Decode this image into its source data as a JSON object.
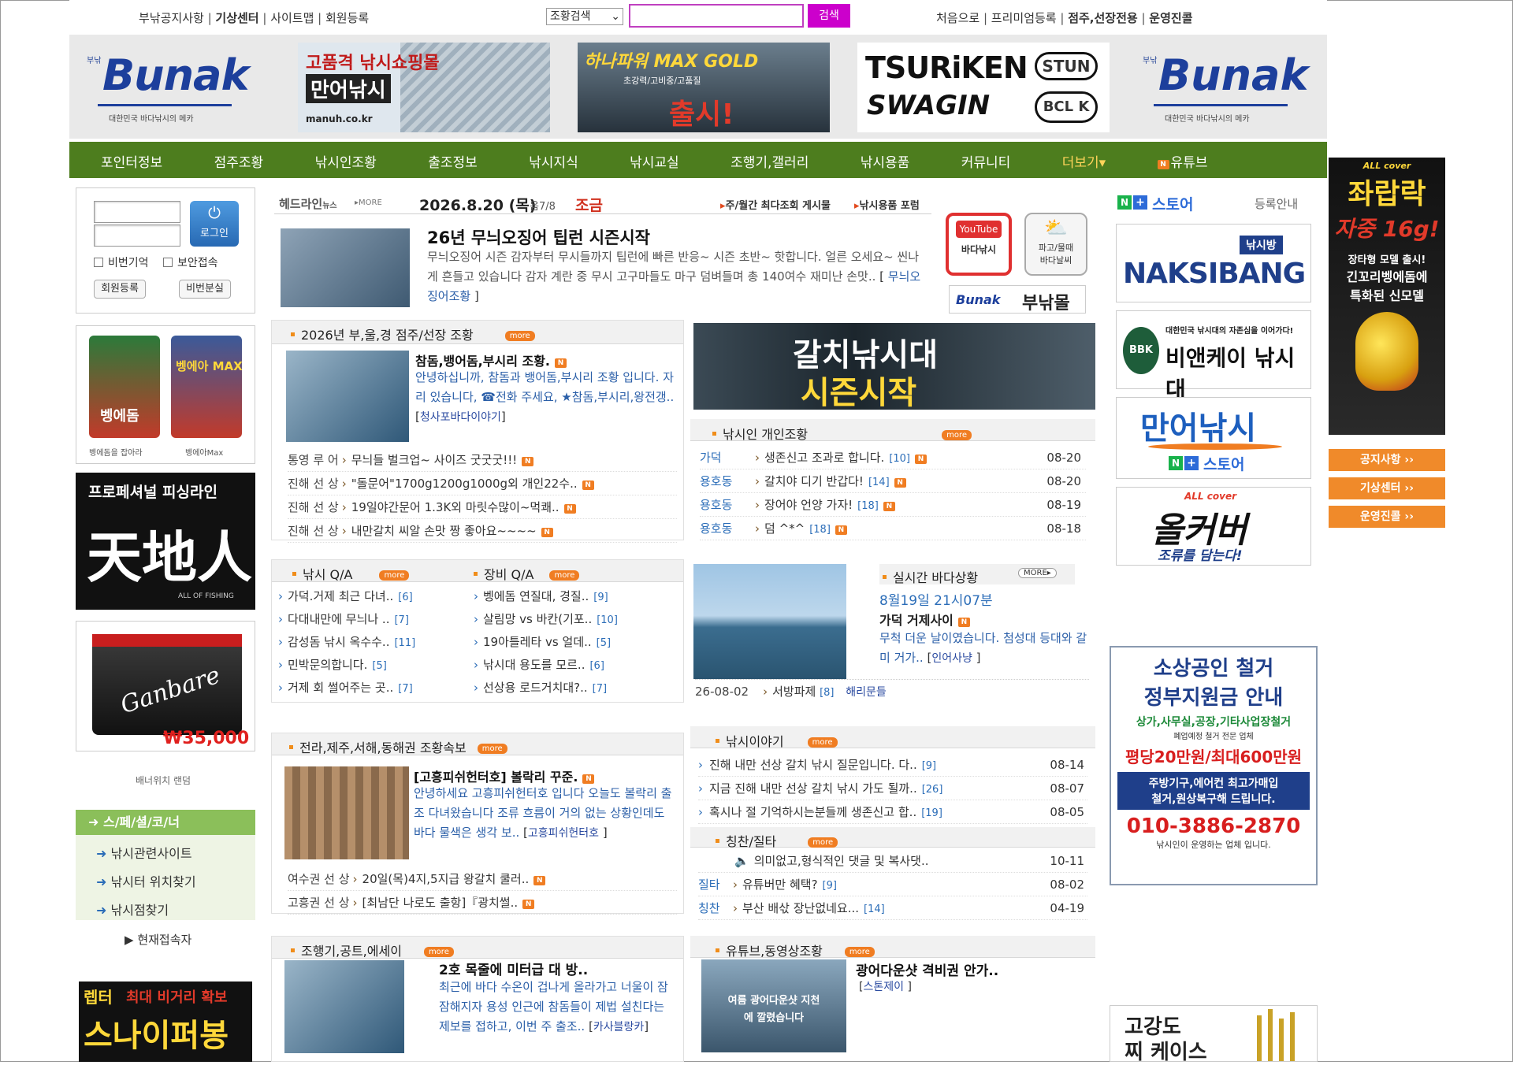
{
  "topbar": {
    "left": [
      "부낚공지사항",
      "기상센터",
      "사이트맵",
      "회원등록"
    ],
    "select": "조황검색",
    "search_btn": "검색",
    "right": [
      "처음으로",
      "프리미엄등록",
      "점주,선장전용",
      "운영진콜"
    ]
  },
  "logo": {
    "brand": "Bunak",
    "small": "부낚",
    "tag": "대한민국 바다낚시의 메카"
  },
  "banners": {
    "b1_line1": "고품격 낚시쇼핑몰",
    "b1_line2": "만어낚시",
    "b1_url": "manuh.co.kr",
    "b2_line1": "하나파워 MAX GOLD",
    "b2_line2": "초강력/고비중/고품질",
    "b2_line3": "출시!",
    "b3_line1": "TSURiKEN",
    "b3_line2": "SWAGIN",
    "b3_badge1": "STUN",
    "b3_badge2": "BCL K"
  },
  "nav": [
    "포인터정보",
    "점주조황",
    "낚시인조황",
    "출조정보",
    "낚시지식",
    "낚시교실",
    "조행기,갤러리",
    "낚시용품",
    "커뮤니티",
    "더보기▾",
    "유튜브"
  ],
  "login": {
    "btn": "로그인",
    "remember": "비번기억",
    "secure": "보안접속",
    "join": "회원등록",
    "lost": "비번분실"
  },
  "left_ads": {
    "ad1_a": "벵에돔",
    "ad1_b": "벵에아 MAX",
    "ad1_c": "벵에돔을 잡아라",
    "ad1_d": "벵에아Max",
    "ad2_a": "프로페셔널 피싱라인",
    "ad2_b": "天地人",
    "ad2_c": "ALL OF FISHING",
    "ad3_a": "Ganbare",
    "ad3_b": "₩35,000",
    "random": "배너위치 랜덤"
  },
  "special": {
    "title": "스/페/셜/코/너",
    "items": [
      "낚시관련사이트",
      "낚시터 위치찾기",
      "낚시점찾기"
    ],
    "online": "현재접속자"
  },
  "bottom_left_ad": {
    "a": "렙터",
    "b": "최대 비거리 확보",
    "c": "스나이퍼봉돌"
  },
  "headline": {
    "label": "헤드라인",
    "label2": "뉴스",
    "more": "MORE",
    "date": "2026.8.20 (목)",
    "lunar": "음7/8",
    "tide": "조금",
    "link1": "주/월간 최다조회 게시물",
    "link2": "낚시용품 포럼",
    "title": "26년 무늬오징어 팁런 시즌시작",
    "body": "무늬오징어 시즌 감자부터 무시들까지 팁런에 빠른 반응~ 시즌 초반~ 핫합니다. 얼른 오세요~ 씬나게 흔들고 있습니다 감자 계란 중 무시 고구마들도 마구 덤벼들며 총 140여수 재미난 손맛..",
    "source": "무늬오징어조황"
  },
  "icons": {
    "yt1": "YouTube",
    "yt2": "바다낚시",
    "wx1": "파고/물때",
    "wx2": "바다날씨",
    "store": "부낚몰"
  },
  "sec_shop": {
    "title": "2026년 부,울,경 점주/선장 조황",
    "more": "more",
    "feat_title": "참돔,뱅어돔,부시리 조황.",
    "feat_body": "안녕하십니까, 참돔과 뱅어돔,부시리 조황 입니다. 자리 있습니다, ☎전화 주세요, ★참돔,부시리,왕전갱..",
    "feat_src": "청사포바다이야기",
    "rows": [
      {
        "who": "통영 루 어",
        "text": "무늬들 벌크업~ 사이즈 굿굿굿!!!"
      },
      {
        "who": "진해 선 상",
        "text": "\"돌문어\"1700g1200g1000g외 개인22수.."
      },
      {
        "who": "진해 선 상",
        "text": "19일야간문어 1.3K외 마릿수많이~먹쾌.."
      },
      {
        "who": "진해 선 상",
        "text": "내만갈치 씨알 손맛 짱 좋아요~~~~"
      }
    ]
  },
  "galchi": {
    "line1": "갈치낚시대",
    "line2": "시즌시작"
  },
  "sec_personal": {
    "title": "낚시인 개인조황",
    "more": "more",
    "rows": [
      {
        "place": "가덕",
        "text": "생존신고 조과로 합니다.",
        "cnt": "[10]",
        "date": "08-20"
      },
      {
        "place": "용호동",
        "text": "갈치야 디기 반갑다!",
        "cnt": "[14]",
        "date": "08-20"
      },
      {
        "place": "용호동",
        "text": "장어야 언양 가자!",
        "cnt": "[18]",
        "date": "08-19"
      },
      {
        "place": "용호동",
        "text": "덤 ^*^",
        "cnt": "[18]",
        "date": "08-18"
      }
    ]
  },
  "sec_qa": {
    "t1": "낚시 Q/A",
    "t2": "장비 Q/A",
    "more": "more",
    "left": [
      {
        "t": "가덕.거제 최근 다녀..",
        "c": "[6]"
      },
      {
        "t": "다대내만에 무늬나 ..",
        "c": "[7]"
      },
      {
        "t": "감성돔 낚시 옥수수..",
        "c": "[11]"
      },
      {
        "t": "민박문의합니다.",
        "c": "[5]"
      },
      {
        "t": "거제 회 썰어주는 곳..",
        "c": "[7]"
      }
    ],
    "right": [
      {
        "t": "벵에돔 연질대, 경질..",
        "c": "[9]"
      },
      {
        "t": "살림망 vs 바칸(기포..",
        "c": "[10]"
      },
      {
        "t": "19아틀레타 vs 얼데..",
        "c": "[5]"
      },
      {
        "t": "낚시대 용도를 모르..",
        "c": "[6]"
      },
      {
        "t": "선상용 로드거치대?..",
        "c": "[7]"
      }
    ]
  },
  "sec_realtime": {
    "title": "실시간 바다상황",
    "more": "MORE▸",
    "time": "8월19일 21시07분",
    "place": "가덕 거제사이",
    "body": "무척 더운 날이였습니다. 첨성대 등대와 갈미 거가..",
    "src": "인어사냥",
    "foot_date": "26-08-02",
    "foot_text": "서방파제",
    "foot_cnt": "[8]",
    "foot_src": "해리문들"
  },
  "sec_region": {
    "title": "전라,제주,서해,동해권 조황속보",
    "more": "more",
    "feat_title": "[고흥피쉬헌터호] 볼락리 꾸준.",
    "feat_body": "안녕하세요 고흥피쉬헌터호 입니다 오늘도 볼락리 출조 다녀왔습니다 조류 흐름이 거의 없는 상황인데도 바다 물색은 생각 보..",
    "feat_src": "고흥피쉬헌터호",
    "rows": [
      {
        "who": "여수권 선 상",
        "text": "20일(목)4지,5지급 왕갈치 쿨러.."
      },
      {
        "who": "고흥권 선 상",
        "text": "[최남단 나로도 출항]『광치썰.."
      }
    ]
  },
  "sec_story": {
    "title": "낚시이야기",
    "more": "more",
    "rows": [
      {
        "t": "진해 내만 선상 갈치 낚시 질문입니다. 다..",
        "c": "[9]",
        "d": "08-14"
      },
      {
        "t": "지금 진해 내만 선상 갈치 낚시 가도 될까..",
        "c": "[26]",
        "d": "08-07"
      },
      {
        "t": "혹시나 절 기억하시는분들께 생존신고 합..",
        "c": "[19]",
        "d": "08-05"
      }
    ]
  },
  "sec_praise": {
    "title": "칭찬/질타",
    "more": "more",
    "rows": [
      {
        "p": "",
        "t": "의미없고,형식적인 댓글 및 복사댓..",
        "c": "",
        "d": "10-11"
      },
      {
        "p": "질타",
        "t": "유튜버만 혜택?",
        "c": "[9]",
        "d": "08-02"
      },
      {
        "p": "칭찬",
        "t": "부산 배삯 장난없네요...",
        "c": "[14]",
        "d": "04-19"
      }
    ]
  },
  "sec_essay": {
    "title": "조행기,공트,에세이",
    "more": "more",
    "feat_title": "2호 목줄에 미터급 대 방..",
    "feat_body": "최근에 바다 수온이 겁나게 올라가고 너울이 잠잠해지자 용성 인근에 참돔들이 제법 설친다는 제보를 접하고, 이번 주 출조..",
    "feat_src": "카사블랑카"
  },
  "sec_video": {
    "title": "유튜브,동영상조황",
    "more": "more",
    "thumb": "여름 광어다운샷 지천에 깔렸습니다",
    "feat_title": "광어다운샷 격비권 안가..",
    "feat_src": "스톤제이"
  },
  "right_col": {
    "store": "스토어",
    "store_reg": "등록안내",
    "a1_small": "낚시방",
    "a1_brand": "NAKSIBANG",
    "a2_small": "대한민국 낚시대의 자존심을 이어가다!",
    "a2_brand": "비앤케이 낚시대",
    "a2_logo": "BBK",
    "a3_brand": "만어낚시",
    "a3_store": "스토어",
    "a4_top": "ALL cover",
    "a4_brand": "올커버",
    "a4_sub": "조류를 담는다!"
  },
  "far_right": {
    "top": "ALL cover",
    "title": "좌랍락",
    "sub": "자중 16g!",
    "desc1": "장타형 모델 출시!",
    "desc2": "긴꼬리벵에돔에",
    "desc3": "특화된 신모델",
    "btn1": "공지사항 ››",
    "btn2": "기상센터 ››",
    "btn3": "운영진콜 ››"
  },
  "scrap_ad": {
    "l1": "소상공인 철거",
    "l2": "정부지원금 안내",
    "l3": "상가,사무실,공장,기타사업장철거",
    "l4": "폐업예정 철거 전문 업체",
    "l5": "평당20만원/최대600만원",
    "l6": "주방기구,에어컨 최고가매입",
    "l7": "철거,원상복구해 드립니다.",
    "l8": "010-3886-2870",
    "l9": "낚시인이 운영하는 업체 입니다."
  },
  "case_ad": {
    "l1": "고강도",
    "l2": "찌 케이스"
  },
  "colors": {
    "nav_green": "#4d7d1e",
    "accent_orange": "#f07d22",
    "magenta": "#cc00cc",
    "special_green": "#8bbf5a"
  }
}
